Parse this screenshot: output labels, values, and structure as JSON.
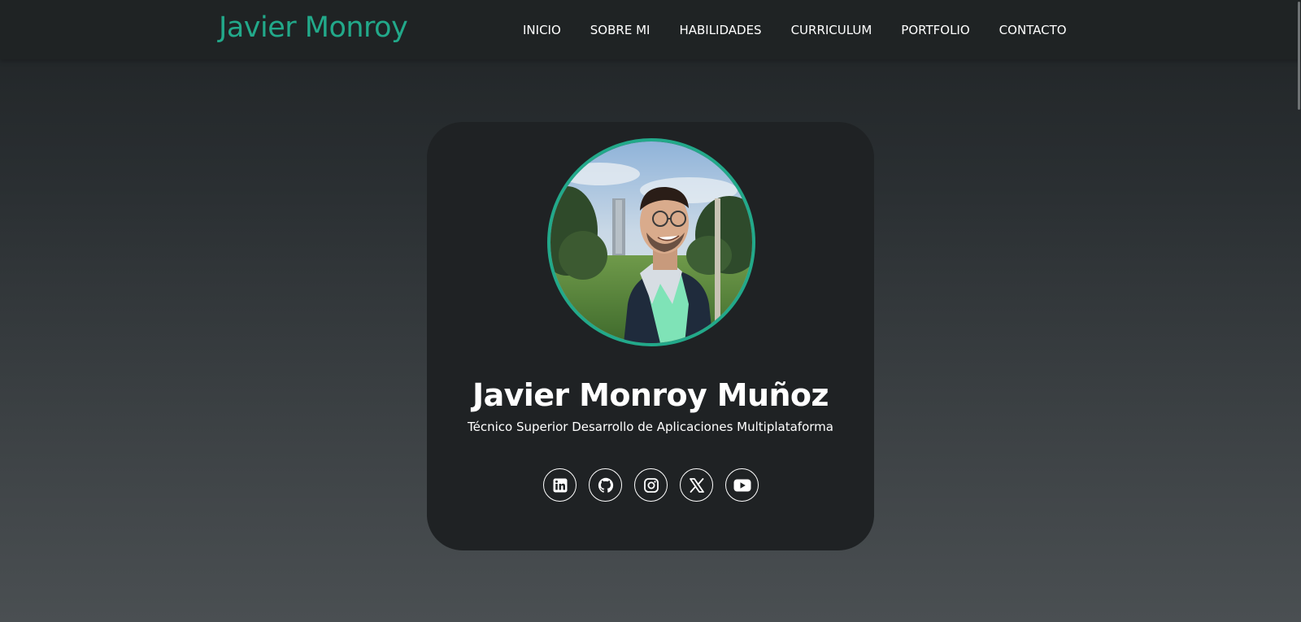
{
  "header": {
    "brand": "Javier Monroy",
    "nav": [
      "INICIO",
      "SOBRE MI",
      "HABILIDADES",
      "CURRICULUM",
      "PORTFOLIO",
      "CONTACTO"
    ]
  },
  "profile": {
    "name": "Javier Monroy Muñoz",
    "title": "Técnico Superior Desarrollo de Aplicaciones Multiplataforma",
    "photo_icon": "profile-photo"
  },
  "social": [
    {
      "icon": "linkedin-icon"
    },
    {
      "icon": "github-icon"
    },
    {
      "icon": "instagram-icon"
    },
    {
      "icon": "x-icon"
    },
    {
      "icon": "youtube-icon"
    }
  ],
  "colors": {
    "accent": "#22a98a",
    "navbar": "#1f2324",
    "card": "#1f2224",
    "text": "#ffffff"
  }
}
